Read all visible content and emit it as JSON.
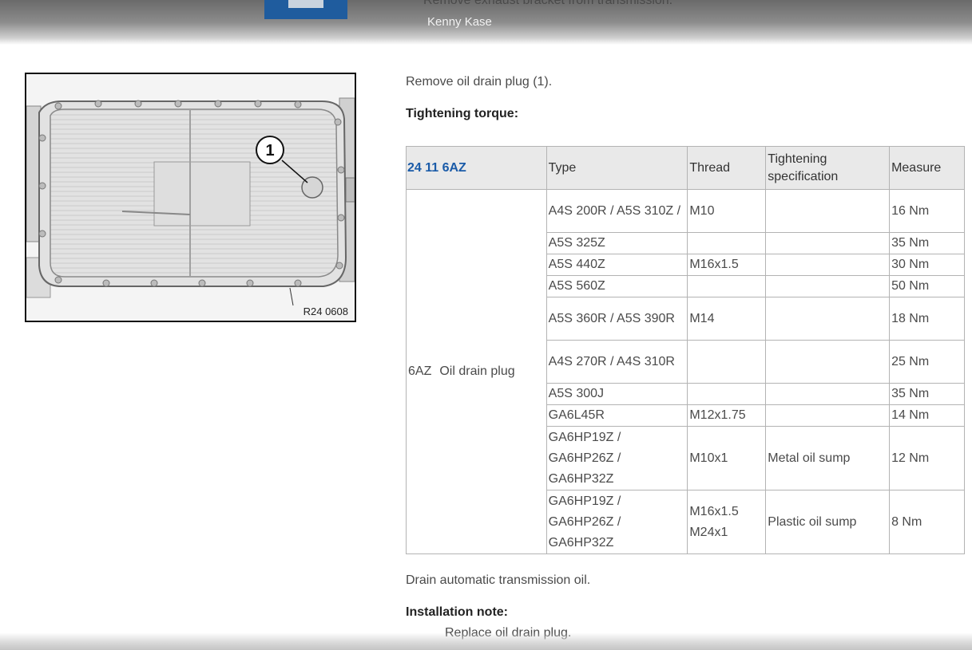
{
  "header": {
    "previous_step": "Remove exhaust bracket from transmission.",
    "author": "Kenny Kase"
  },
  "figure": {
    "callout": "1",
    "code": "R24 0608"
  },
  "steps": {
    "remove_plug": "Remove oil drain plug (1).",
    "torque_heading": "Tightening torque:",
    "drain": "Drain automatic transmission oil.",
    "install_heading": "Installation note:",
    "install_text": "Replace oil drain plug."
  },
  "table": {
    "headers": {
      "code": "24 11 6AZ",
      "type": "Type",
      "thread": "Thread",
      "spec": "Tightening specification",
      "measure": "Measure"
    },
    "part": {
      "code": "6AZ",
      "name": "Oil drain plug"
    },
    "rows": [
      {
        "type": "A4S 200R / A5S 310Z /",
        "thread": "M10",
        "spec": "",
        "measure": "16 Nm"
      },
      {
        "type": "A5S 325Z",
        "thread": "",
        "spec": "",
        "measure": "35 Nm"
      },
      {
        "type": "A5S 440Z",
        "thread": "M16x1.5",
        "spec": "",
        "measure": "30 Nm"
      },
      {
        "type": "A5S 560Z",
        "thread": "",
        "spec": "",
        "measure": "50 Nm"
      },
      {
        "type": "A5S 360R / A5S 390R",
        "thread": "M14",
        "spec": "",
        "measure": "18 Nm"
      },
      {
        "type": "A4S 270R / A4S 310R",
        "thread": "",
        "spec": "",
        "measure": "25 Nm"
      },
      {
        "type": "A5S 300J",
        "thread": "",
        "spec": "",
        "measure": "35 Nm"
      },
      {
        "type": "GA6L45R",
        "thread": "M12x1.75",
        "spec": "",
        "measure": "14 Nm"
      },
      {
        "type": "GA6HP19Z / GA6HP26Z / GA6HP32Z",
        "thread": "M10x1",
        "spec": "Metal oil sump",
        "measure": "12 Nm"
      },
      {
        "type": "GA6HP19Z / GA6HP26Z / GA6HP32Z",
        "thread": "M16x1.5 M24x1",
        "spec": "Plastic oil sump",
        "measure": "8 Nm"
      }
    ]
  },
  "colors": {
    "link_blue": "#1a5ba8",
    "logo_blue": "#1f5c9e",
    "border_gray": "#b3b3b3"
  }
}
